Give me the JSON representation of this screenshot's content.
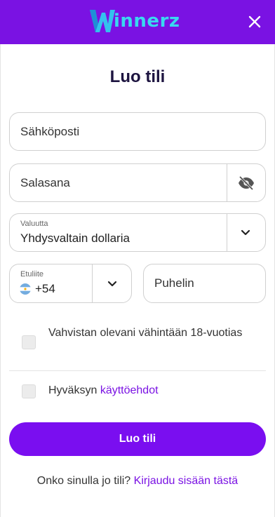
{
  "header": {
    "logo_text": "innerz",
    "logo_color": "#39d8f0",
    "background": "#7a12e3",
    "close_icon": "close-icon"
  },
  "form": {
    "title": "Luo tili",
    "email_placeholder": "Sähköposti",
    "password_placeholder": "Salasana",
    "password_toggle_icon": "eye-slash-icon",
    "currency": {
      "label": "Valuutta",
      "value": "Yhdysvaltain dollaria"
    },
    "phone_prefix": {
      "label": "Etuliite",
      "flag_icon": "argentina-flag-icon",
      "value": "+54"
    },
    "phone_placeholder": "Puhelin",
    "age_check_label": "Vahvistan olevani vähintään 18-vuotias",
    "terms_prefix": "Hyväksyn",
    "terms_link": "käyttöehdot",
    "submit_label": "Luo tili"
  },
  "footer": {
    "question": "Onko sinulla jo tili?",
    "login_link": "Kirjaudu sisään tästä"
  },
  "colors": {
    "accent": "#7a0ef0",
    "title": "#1d1440"
  }
}
